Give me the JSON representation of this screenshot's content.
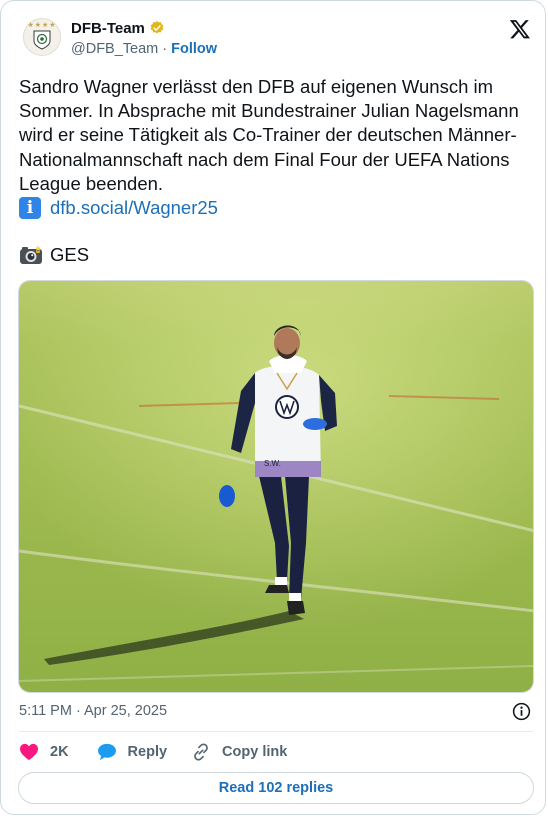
{
  "author": {
    "display_name": "DFB-Team",
    "handle": "@DFB_Team",
    "separator": "·",
    "follow_label": "Follow"
  },
  "tweet": {
    "text": "Sandro Wagner verlässt den DFB auf eigenen Wunsch im Sommer. In Absprache mit Bundestrainer Julian Nagelsmann wird er seine Tätigkeit als Co-Trainer der deutschen Männer-Nationalmannschaft nach dem Final Four der UEFA Nations League beenden.",
    "info_emoji": "i",
    "link_text": "dfb.social/Wagner25",
    "photo_credit": "GES"
  },
  "photo": {
    "initials_on_shirt": "S.W."
  },
  "meta": {
    "timestamp": "5:11 PM · Apr 25, 2025"
  },
  "actions": {
    "like_count": "2K",
    "reply_label": "Reply",
    "copy_link_label": "Copy link"
  },
  "read_replies_label": "Read 102 replies",
  "icons": {
    "verified": "verified-badge-icon",
    "x_logo": "x-logo-icon",
    "info": "info-icon",
    "like": "heart-icon",
    "reply": "speech-bubble-icon",
    "copy_link": "link-icon",
    "camera": "camera-emoji-icon"
  },
  "colors": {
    "accent": "#1d6fb8",
    "like": "#f91880",
    "reply": "#1d9bf0",
    "verified": "#e2b719",
    "text_secondary": "#536471",
    "border": "#cfd9de"
  }
}
